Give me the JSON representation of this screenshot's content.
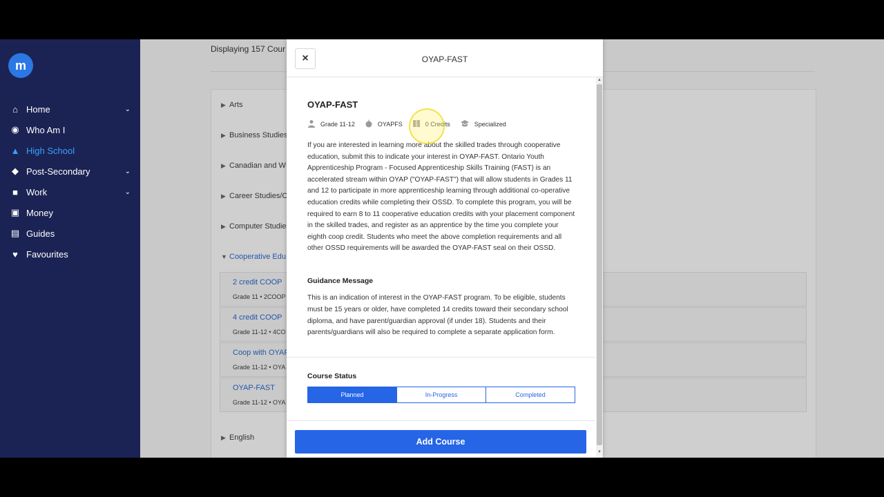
{
  "sidebar": {
    "logo_letter": "m",
    "items": [
      {
        "label": "Home",
        "icon": "home-icon",
        "glyph": "⌂",
        "chevron": "⌄"
      },
      {
        "label": "Who Am I",
        "icon": "user-circle-icon",
        "glyph": "◉",
        "chevron": ""
      },
      {
        "label": "High School",
        "icon": "graduation-cap-icon",
        "glyph": "▲",
        "chevron": ""
      },
      {
        "label": "Post-Secondary",
        "icon": "graduation-cap-icon",
        "glyph": "◆",
        "chevron": "⌄"
      },
      {
        "label": "Work",
        "icon": "briefcase-icon",
        "glyph": "■",
        "chevron": "⌄"
      },
      {
        "label": "Money",
        "icon": "money-icon",
        "glyph": "▣",
        "chevron": ""
      },
      {
        "label": "Guides",
        "icon": "book-icon",
        "glyph": "▤",
        "chevron": ""
      },
      {
        "label": "Favourites",
        "icon": "heart-icon",
        "glyph": "♥",
        "chevron": ""
      }
    ],
    "active_index": 2
  },
  "page": {
    "display_count": "Displaying 157 Cour",
    "categories": [
      "Arts",
      "Business Studies",
      "Canadian and W",
      "Career Studies/C",
      "Computer Studie",
      "Cooperative Edu"
    ],
    "sub_courses": [
      {
        "title": "2 credit COOP",
        "meta": "Grade 11 • 2COOP"
      },
      {
        "title": "4 credit COOP",
        "meta": "Grade 11-12 • 4CO"
      },
      {
        "title": "Coop with OYAP",
        "meta": "Grade 11-12 • OYA"
      },
      {
        "title": "OYAP-FAST",
        "meta": "Grade 11-12 • OYA"
      }
    ],
    "next_category": "English"
  },
  "modal": {
    "header_title": "OYAP-FAST",
    "close_glyph": "×",
    "course_name": "OYAP-FAST",
    "meta": {
      "grade": "Grade 11-12",
      "code": "OYAPFS",
      "credits": "0 Credits",
      "type": "Specialized"
    },
    "description": "If you are interested in learning more about the skilled trades through cooperative education, submit this to indicate your interest in OYAP-FAST. Ontario Youth Apprenticeship Program - Focused Apprenticeship Skills Training (FAST) is an accelerated stream within OYAP (\"OYAP-FAST\") that will allow students in Grades 11 and 12 to participate in more apprenticeship learning through additional co-operative education credits while completing their OSSD. To complete this program, you will be required to earn 8 to 11 cooperative education credits with your placement component in the skilled trades, and register as an apprentice by the time you complete your eighth coop credit. Students who meet the above completion requirements and all other OSSD requirements will be awarded the OYAP-FAST seal on their OSSD.",
    "guidance_heading": "Guidance Message",
    "guidance_text": "This is an indication of interest in the OYAP-FAST program. To be eligible, students must be 15 years or older, have completed 14 credits toward their secondary school diploma, and have parent/guardian approval (if under 18). Students and their parents/guardians will also be required to complete a separate application form.",
    "status_heading": "Course Status",
    "status_options": [
      "Planned",
      "In-Progress",
      "Completed"
    ],
    "status_selected": "Planned",
    "add_button": "Add Course"
  },
  "colors": {
    "sidebar_bg": "#1b2354",
    "accent": "#2565e6",
    "active_nav": "#3aa0ff"
  }
}
